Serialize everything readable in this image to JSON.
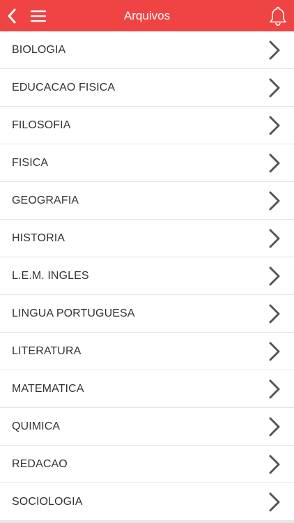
{
  "header": {
    "title": "Arquivos",
    "background_color": "#f04343",
    "back_icon": "chevron-left-icon",
    "menu_icon": "hamburger-menu-icon",
    "notification_icon": "bell-icon"
  },
  "list": {
    "items": [
      {
        "label": "BIOLOGIA"
      },
      {
        "label": "EDUCACAO FISICA"
      },
      {
        "label": "FILOSOFIA"
      },
      {
        "label": "FISICA"
      },
      {
        "label": "GEOGRAFIA"
      },
      {
        "label": "HISTORIA"
      },
      {
        "label": "L.E.M. INGLES"
      },
      {
        "label": "LINGUA PORTUGUESA"
      },
      {
        "label": "LITERATURA"
      },
      {
        "label": "MATEMATICA"
      },
      {
        "label": "QUIMICA"
      },
      {
        "label": "REDACAO"
      },
      {
        "label": "SOCIOLOGIA"
      }
    ],
    "item_icon": "chevron-right-icon"
  }
}
